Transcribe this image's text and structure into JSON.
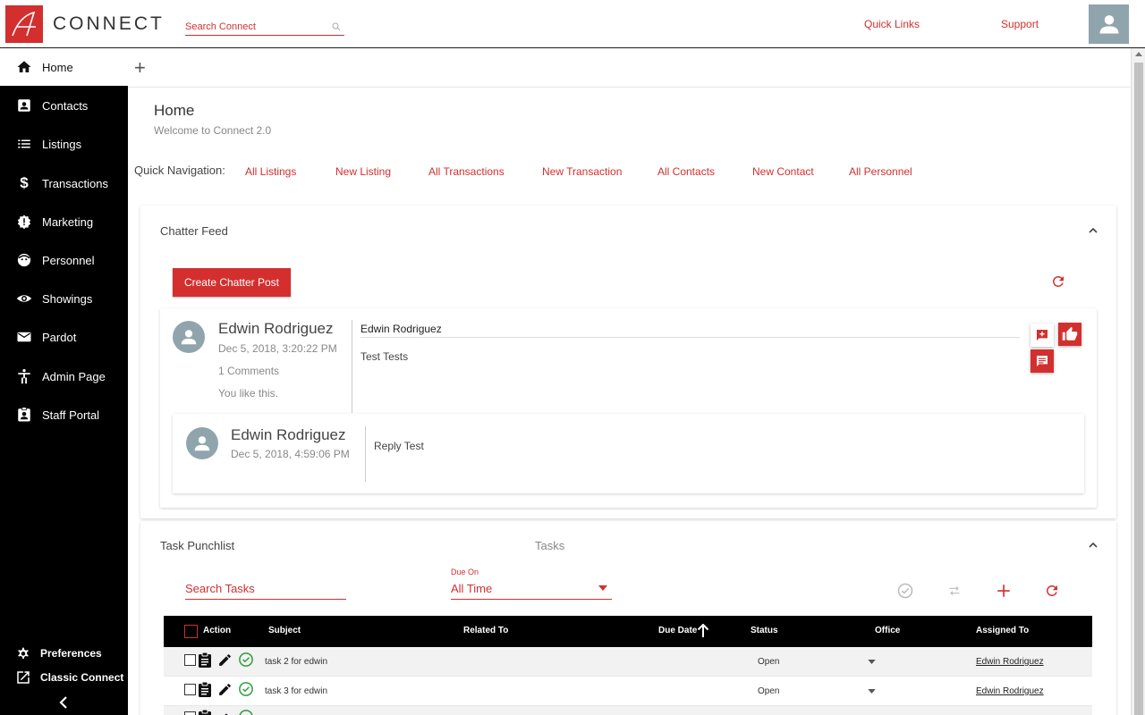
{
  "header": {
    "brand": "CONNECT",
    "search_placeholder": "Search Connect",
    "links": [
      "Quick Links",
      "Support"
    ],
    "accent": "#d32f2f"
  },
  "sidebar": {
    "items": [
      {
        "label": "Home",
        "icon": "home-icon",
        "active": true
      },
      {
        "label": "Contacts",
        "icon": "contacts-icon"
      },
      {
        "label": "Listings",
        "icon": "list-icon"
      },
      {
        "label": "Transactions",
        "icon": "dollar-icon"
      },
      {
        "label": "Marketing",
        "icon": "marketing-badge-icon"
      },
      {
        "label": "Personnel",
        "icon": "face-icon"
      },
      {
        "label": "Showings",
        "icon": "eye-icon"
      },
      {
        "label": "Pardot",
        "icon": "mail-icon"
      },
      {
        "label": "Admin Page",
        "icon": "person-icon"
      },
      {
        "label": "Staff Portal",
        "icon": "badge-icon"
      }
    ],
    "bottom": [
      {
        "label": "Preferences",
        "icon": "gear-icon"
      },
      {
        "label": "Classic Connect",
        "icon": "open-external-icon"
      }
    ]
  },
  "page": {
    "title": "Home",
    "subtitle": "Welcome to Connect 2.0",
    "quick_nav_label": "Quick Navigation:",
    "quick_nav": [
      "All Listings",
      "New Listing",
      "All Transactions",
      "New Transaction",
      "All Contacts",
      "New Contact",
      "All Personnel"
    ]
  },
  "chatter": {
    "title": "Chatter Feed",
    "create_label": "Create Chatter Post",
    "post": {
      "author": "Edwin Rodriguez",
      "date": "Dec 5, 2018, 3:20:22 PM",
      "comments": "1 Comments",
      "liked": "You like this.",
      "to": "Edwin Rodriguez",
      "body": "Test Tests"
    },
    "reply": {
      "author": "Edwin Rodriguez",
      "date": "Dec 5, 2018, 4:59:06 PM",
      "body": "Reply Test"
    }
  },
  "tasks": {
    "title": "Task Punchlist",
    "center_title": "Tasks",
    "search_placeholder": "Search Tasks",
    "due_label": "Due On",
    "due_value": "All Time",
    "columns": [
      "Action",
      "Subject",
      "Related To",
      "Due Date",
      "Status",
      "Office",
      "Assigned To"
    ],
    "rows": [
      {
        "subject": "task 2 for edwin",
        "related": "",
        "due": "",
        "status": "Open",
        "assigned": "Edwin Rodriguez"
      },
      {
        "subject": "task 3 for edwin",
        "related": "",
        "due": "",
        "status": "Open",
        "assigned": "Edwin Rodriguez"
      }
    ]
  }
}
